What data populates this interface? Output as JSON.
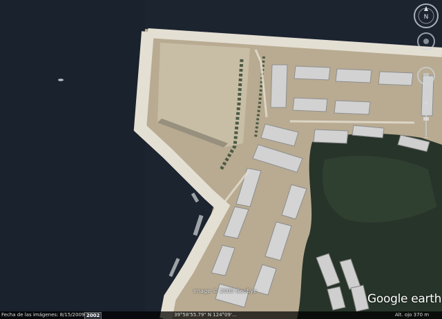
{
  "map": {
    "credit": "Image © 2009 GeoEye",
    "status": {
      "imagery_date": "Fecha de las imágenes: 8/15/2009",
      "year_badge": "2002",
      "coords": "39°58'55.79\" N 124°09'...",
      "eye_alt": "Alt. ojo   370 m"
    },
    "logo": {
      "word1": "Google",
      "word2": " earth"
    },
    "controls": {
      "compass_letter": "N"
    },
    "colors": {
      "water": "#1c2430",
      "pier": "#d6d0c2",
      "ground": "#b8ab92",
      "forest": "#27342a",
      "roof": "#d2d2d2"
    }
  }
}
